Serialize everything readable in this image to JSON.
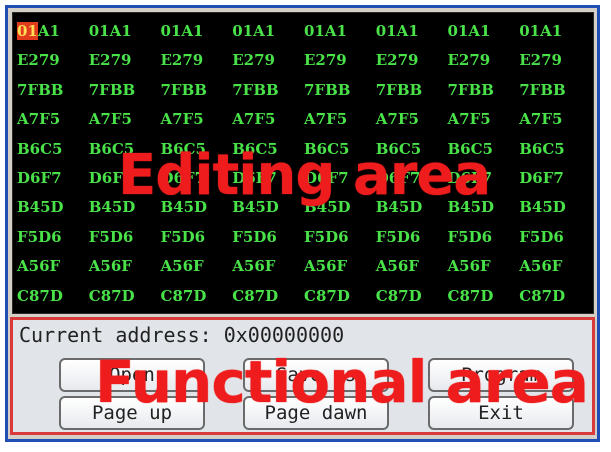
{
  "editing_area": {
    "label": "Editing area",
    "first_cell_highlight": "01",
    "first_cell_rest": "A1",
    "rows": [
      [
        "01A1",
        "01A1",
        "01A1",
        "01A1",
        "01A1",
        "01A1",
        "01A1",
        "01A1"
      ],
      [
        "E279",
        "E279",
        "E279",
        "E279",
        "E279",
        "E279",
        "E279",
        "E279"
      ],
      [
        "7FBB",
        "7FBB",
        "7FBB",
        "7FBB",
        "7FBB",
        "7FBB",
        "7FBB",
        "7FBB"
      ],
      [
        "A7F5",
        "A7F5",
        "A7F5",
        "A7F5",
        "A7F5",
        "A7F5",
        "A7F5",
        "A7F5"
      ],
      [
        "B6C5",
        "B6C5",
        "B6C5",
        "B6C5",
        "B6C5",
        "B6C5",
        "B6C5",
        "B6C5"
      ],
      [
        "D6F7",
        "D6F7",
        "D6F7",
        "D6F7",
        "D6F7",
        "D6F7",
        "D6F7",
        "D6F7"
      ],
      [
        "B45D",
        "B45D",
        "B45D",
        "B45D",
        "B45D",
        "B45D",
        "B45D",
        "B45D"
      ],
      [
        "F5D6",
        "F5D6",
        "F5D6",
        "F5D6",
        "F5D6",
        "F5D6",
        "F5D6",
        "F5D6"
      ],
      [
        "A56F",
        "A56F",
        "A56F",
        "A56F",
        "A56F",
        "A56F",
        "A56F",
        "A56F"
      ],
      [
        "C87D",
        "C87D",
        "C87D",
        "C87D",
        "C87D",
        "C87D",
        "C87D",
        "C87D"
      ]
    ]
  },
  "functional_area": {
    "label": "Functional area",
    "address_label": "Current address:",
    "address_value": "0x00000000",
    "buttons": {
      "open": "Open",
      "save": "Save as",
      "program": "Program",
      "page_up": "Page up",
      "page_down": "Page dawn",
      "exit": "Exit"
    }
  },
  "colors": {
    "frame_border": "#1f4fb4",
    "hex_text": "#49e249",
    "overlay_text": "#ee1c1c",
    "cursor_highlight": "#e23a1c"
  }
}
